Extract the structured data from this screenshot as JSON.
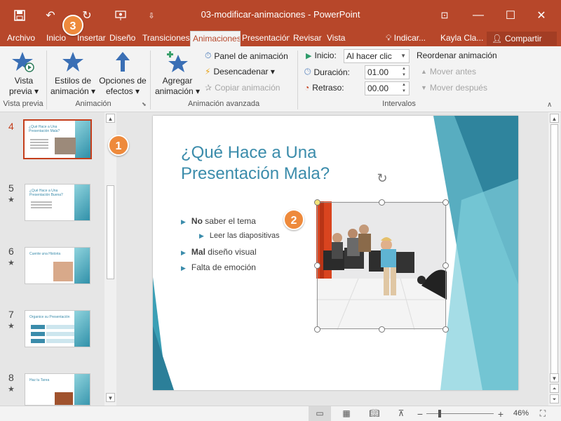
{
  "window": {
    "title": "03-modificar-animaciones  -  PowerPoint"
  },
  "tabs": [
    "Archivo",
    "Inicio",
    "Insertar",
    "Diseño",
    "Transiciones",
    "Animaciones",
    "Presentación",
    "Revisar",
    "Vista"
  ],
  "tell_me": "Indicar...",
  "user": "Kayla Cla...",
  "share_label": "Compartir",
  "ribbon": {
    "preview": {
      "label1": "Vista",
      "label2": "previa ▾",
      "group": "Vista previa"
    },
    "animation_styles": {
      "label1": "Estilos de",
      "label2": "animación ▾"
    },
    "effect_options": {
      "label1": "Opciones de",
      "label2": "efectos ▾"
    },
    "animation_group": "Animación",
    "add_animation": {
      "label1": "Agregar",
      "label2": "animación ▾"
    },
    "animation_pane": "Panel de animación",
    "trigger": "Desencadenar ▾",
    "copy_animation": "Copiar animación",
    "advanced_group": "Animación avanzada",
    "start_label": "Inicio:",
    "start_value": "Al hacer clic",
    "duration_label": "Duración:",
    "duration_value": "01.00",
    "delay_label": "Retraso:",
    "delay_value": "00.00",
    "reorder_title": "Reordenar animación",
    "move_earlier": "Mover antes",
    "move_later": "Mover después",
    "timing_group": "Intervalos"
  },
  "thumbnails": [
    {
      "num": "4",
      "star": "",
      "title": "¿Qué Hace a Una Presentación Mala?"
    },
    {
      "num": "5",
      "star": "★",
      "title": "¿Qué Hace a Una Presentación Buena?"
    },
    {
      "num": "6",
      "star": "★",
      "title": "Cuente una Historia"
    },
    {
      "num": "7",
      "star": "★",
      "title": "Organice su Presentación"
    },
    {
      "num": "8",
      "star": "★",
      "title": "Haz tu Tarea"
    }
  ],
  "slide": {
    "title": "¿Qué Hace a Una Presentación Mala?",
    "bullets": [
      {
        "bold": "No",
        "text": " saber el tema"
      },
      {
        "bold": "",
        "text": "Leer las diapositivas"
      },
      {
        "bold": "Mal",
        "text": " diseño visual"
      },
      {
        "bold": "",
        "text": "Falta de emoción"
      }
    ]
  },
  "callouts": [
    "1",
    "2",
    "3"
  ],
  "status": {
    "zoom": "46%",
    "zoom_minus": "−",
    "zoom_plus": "+"
  },
  "colors": {
    "accent": "#b7472a",
    "teal": "#3b8cab",
    "callout": "#ee8a3c"
  }
}
